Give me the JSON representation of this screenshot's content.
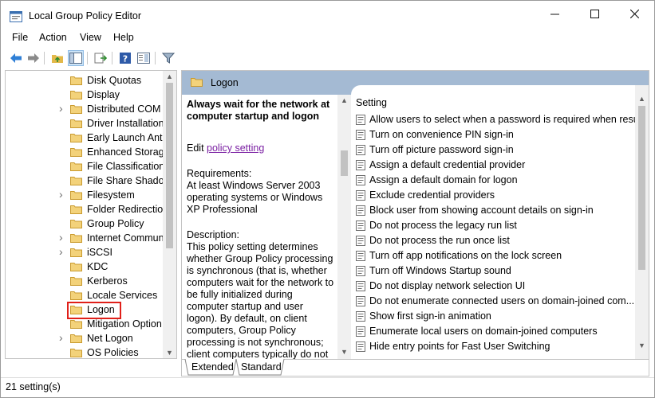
{
  "window": {
    "title": "Local Group Policy Editor"
  },
  "menu": [
    "File",
    "Action",
    "View",
    "Help"
  ],
  "tree": {
    "items": [
      {
        "label": "Disk Quotas",
        "expandable": false
      },
      {
        "label": "Display",
        "expandable": false
      },
      {
        "label": "Distributed COM",
        "expandable": true
      },
      {
        "label": "Driver Installation",
        "expandable": false
      },
      {
        "label": "Early Launch Antir",
        "expandable": false
      },
      {
        "label": "Enhanced Storage",
        "expandable": false
      },
      {
        "label": "File Classification I",
        "expandable": false
      },
      {
        "label": "File Share Shadow",
        "expandable": false
      },
      {
        "label": "Filesystem",
        "expandable": true
      },
      {
        "label": "Folder Redirection",
        "expandable": false
      },
      {
        "label": "Group Policy",
        "expandable": false
      },
      {
        "label": "Internet Commun",
        "expandable": true
      },
      {
        "label": "iSCSI",
        "expandable": true
      },
      {
        "label": "KDC",
        "expandable": false
      },
      {
        "label": "Kerberos",
        "expandable": false
      },
      {
        "label": "Locale Services",
        "expandable": false
      },
      {
        "label": "Logon",
        "expandable": false,
        "selected": true
      },
      {
        "label": "Mitigation Option",
        "expandable": false
      },
      {
        "label": "Net Logon",
        "expandable": true
      },
      {
        "label": "OS Policies",
        "expandable": false
      }
    ]
  },
  "panel": {
    "header": "Logon",
    "description": {
      "title": "Always wait for the network at computer startup and logon",
      "edit_prefix": "Edit ",
      "edit_link": "policy setting",
      "requirements_label": "Requirements:",
      "requirements_text": "At least Windows Server 2003 operating systems or Windows XP Professional",
      "description_label": "Description:",
      "description_text": "This policy setting determines whether Group Policy processing is synchronous (that is, whether computers wait for the network to be fully initialized during computer startup and user logon). By default, on client computers, Group Policy processing is not synchronous; client computers typically do not wait for the network to be fully initialized at"
    },
    "list_header": "Setting",
    "settings": [
      "Allow users to select when a password is required when resu...",
      "Turn on convenience PIN sign-in",
      "Turn off picture password sign-in",
      "Assign a default credential provider",
      "Assign a default domain for logon",
      "Exclude credential providers",
      "Block user from showing account details on sign-in",
      "Do not process the legacy run list",
      "Do not process the run once list",
      "Turn off app notifications on the lock screen",
      "Turn off Windows Startup sound",
      "Do not display network selection UI",
      "Do not enumerate connected users on domain-joined com...",
      "Show first sign-in animation",
      "Enumerate local users on domain-joined computers",
      "Hide entry points for Fast User Switching"
    ],
    "tabs": [
      "Extended",
      "Standard"
    ]
  },
  "status": {
    "text": "21 setting(s)"
  },
  "colors": {
    "header_band": "#a4bad3",
    "selection_outline": "#e0201a",
    "link": "#7a1fa2"
  }
}
